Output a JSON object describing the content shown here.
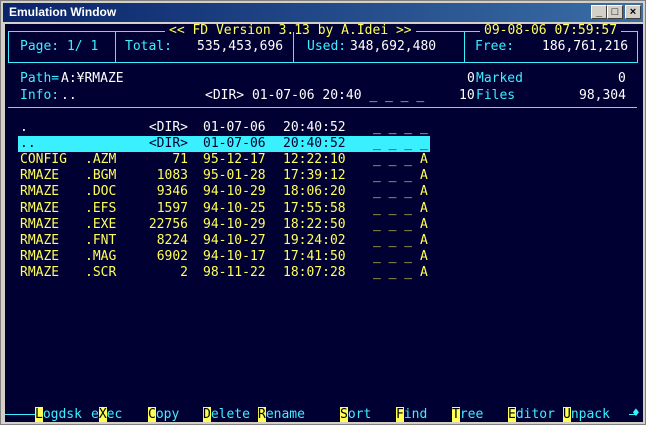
{
  "window": {
    "title": "Emulation Window",
    "controls": [
      "_",
      "□",
      "×"
    ]
  },
  "header": {
    "program": "<< FD Version 3.13 by A.Idei >>",
    "datetime": "09-08-06 07:59:57",
    "page": "Page: 1/ 1",
    "total_label": "Total:",
    "total_value": "535,453,696",
    "used_label": "Used:",
    "used_value": "348,692,480",
    "free_label": "Free:",
    "free_value": "186,761,216"
  },
  "info": {
    "path_label": "Path=",
    "path_value": "A:¥RMAZE",
    "info_label": "Info:",
    "info_value": "..",
    "info_detail": "<DIR> 01-07-06 20:40 _ _ _ _",
    "marked_count": "0",
    "marked_label": "Marked",
    "marked_value": "0",
    "files_count": "10",
    "files_label": "Files",
    "files_value": "98,304"
  },
  "files": [
    {
      "name": ".",
      "ext": "",
      "size": "<DIR>",
      "date": "01-07-06",
      "time": "20:40:52",
      "attr": "_ _ _ _",
      "selected": false,
      "color": "white"
    },
    {
      "name": "..",
      "ext": "",
      "size": "<DIR>",
      "date": "01-07-06",
      "time": "20:40:52",
      "attr": "_ _ _ _",
      "selected": true,
      "color": "white"
    },
    {
      "name": "CONFIG",
      "ext": ".AZM",
      "size": "71",
      "date": "95-12-17",
      "time": "12:22:10",
      "attr": "_ _ _ A",
      "selected": false,
      "color": "yellow"
    },
    {
      "name": "RMAZE",
      "ext": ".BGM",
      "size": "1083",
      "date": "95-01-28",
      "time": "17:39:12",
      "attr": "_ _ _ A",
      "selected": false,
      "color": "yellow"
    },
    {
      "name": "RMAZE",
      "ext": ".DOC",
      "size": "9346",
      "date": "94-10-29",
      "time": "18:06:20",
      "attr": "_ _ _ A",
      "selected": false,
      "color": "yellow"
    },
    {
      "name": "RMAZE",
      "ext": ".EFS",
      "size": "1597",
      "date": "94-10-25",
      "time": "17:55:58",
      "attr": "_ _ _ A",
      "selected": false,
      "color": "yellow"
    },
    {
      "name": "RMAZE",
      "ext": ".EXE",
      "size": "22756",
      "date": "94-10-29",
      "time": "18:22:50",
      "attr": "_ _ _ A",
      "selected": false,
      "color": "yellow"
    },
    {
      "name": "RMAZE",
      "ext": ".FNT",
      "size": "8224",
      "date": "94-10-27",
      "time": "19:24:02",
      "attr": "_ _ _ A",
      "selected": false,
      "color": "yellow"
    },
    {
      "name": "RMAZE",
      "ext": ".MAG",
      "size": "6902",
      "date": "94-10-17",
      "time": "17:41:50",
      "attr": "_ _ _ A",
      "selected": false,
      "color": "yellow"
    },
    {
      "name": "RMAZE",
      "ext": ".SCR",
      "size": "2",
      "date": "98-11-22",
      "time": "18:07:28",
      "attr": "_ _ _ A",
      "selected": false,
      "color": "yellow"
    }
  ],
  "function_keys": [
    {
      "hot": "L",
      "rest": "ogdsk"
    },
    {
      "pre": "e",
      "hot": "X",
      "rest": "ec"
    },
    {
      "hot": "C",
      "rest": "opy"
    },
    {
      "hot": "D",
      "rest": "elete"
    },
    {
      "hot": "R",
      "rest": "ename"
    },
    {
      "hot": "S",
      "rest": "ort"
    },
    {
      "hot": "F",
      "rest": "ind"
    },
    {
      "hot": "T",
      "rest": "ree"
    },
    {
      "hot": "E",
      "rest": "ditor"
    },
    {
      "hot": "U",
      "rest": "npack"
    }
  ]
}
